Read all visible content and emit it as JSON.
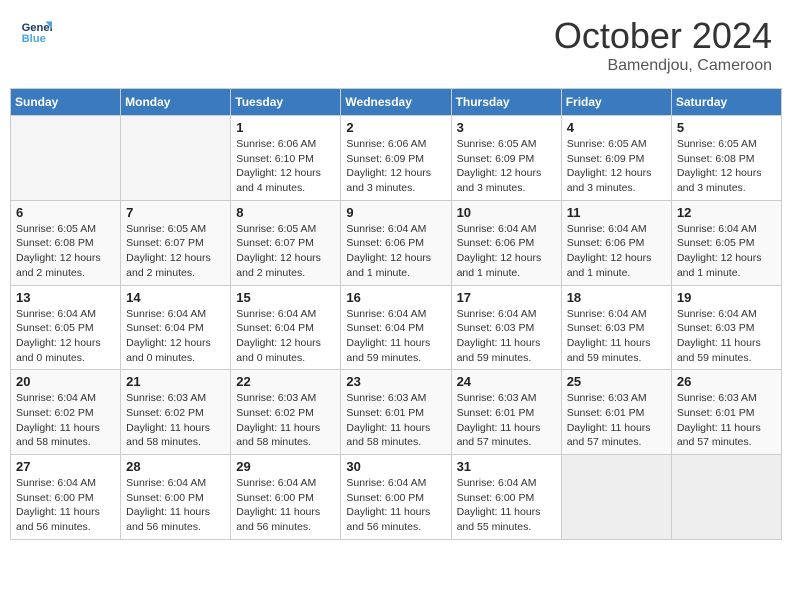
{
  "header": {
    "logo_line1": "General",
    "logo_line2": "Blue",
    "title": "October 2024",
    "location": "Bamendjou, Cameroon"
  },
  "weekdays": [
    "Sunday",
    "Monday",
    "Tuesday",
    "Wednesday",
    "Thursday",
    "Friday",
    "Saturday"
  ],
  "weeks": [
    [
      {
        "day": "",
        "info": ""
      },
      {
        "day": "",
        "info": ""
      },
      {
        "day": "1",
        "info": "Sunrise: 6:06 AM\nSunset: 6:10 PM\nDaylight: 12 hours and 4 minutes."
      },
      {
        "day": "2",
        "info": "Sunrise: 6:06 AM\nSunset: 6:09 PM\nDaylight: 12 hours and 3 minutes."
      },
      {
        "day": "3",
        "info": "Sunrise: 6:05 AM\nSunset: 6:09 PM\nDaylight: 12 hours and 3 minutes."
      },
      {
        "day": "4",
        "info": "Sunrise: 6:05 AM\nSunset: 6:09 PM\nDaylight: 12 hours and 3 minutes."
      },
      {
        "day": "5",
        "info": "Sunrise: 6:05 AM\nSunset: 6:08 PM\nDaylight: 12 hours and 3 minutes."
      }
    ],
    [
      {
        "day": "6",
        "info": "Sunrise: 6:05 AM\nSunset: 6:08 PM\nDaylight: 12 hours and 2 minutes."
      },
      {
        "day": "7",
        "info": "Sunrise: 6:05 AM\nSunset: 6:07 PM\nDaylight: 12 hours and 2 minutes."
      },
      {
        "day": "8",
        "info": "Sunrise: 6:05 AM\nSunset: 6:07 PM\nDaylight: 12 hours and 2 minutes."
      },
      {
        "day": "9",
        "info": "Sunrise: 6:04 AM\nSunset: 6:06 PM\nDaylight: 12 hours and 1 minute."
      },
      {
        "day": "10",
        "info": "Sunrise: 6:04 AM\nSunset: 6:06 PM\nDaylight: 12 hours and 1 minute."
      },
      {
        "day": "11",
        "info": "Sunrise: 6:04 AM\nSunset: 6:06 PM\nDaylight: 12 hours and 1 minute."
      },
      {
        "day": "12",
        "info": "Sunrise: 6:04 AM\nSunset: 6:05 PM\nDaylight: 12 hours and 1 minute."
      }
    ],
    [
      {
        "day": "13",
        "info": "Sunrise: 6:04 AM\nSunset: 6:05 PM\nDaylight: 12 hours and 0 minutes."
      },
      {
        "day": "14",
        "info": "Sunrise: 6:04 AM\nSunset: 6:04 PM\nDaylight: 12 hours and 0 minutes."
      },
      {
        "day": "15",
        "info": "Sunrise: 6:04 AM\nSunset: 6:04 PM\nDaylight: 12 hours and 0 minutes."
      },
      {
        "day": "16",
        "info": "Sunrise: 6:04 AM\nSunset: 6:04 PM\nDaylight: 11 hours and 59 minutes."
      },
      {
        "day": "17",
        "info": "Sunrise: 6:04 AM\nSunset: 6:03 PM\nDaylight: 11 hours and 59 minutes."
      },
      {
        "day": "18",
        "info": "Sunrise: 6:04 AM\nSunset: 6:03 PM\nDaylight: 11 hours and 59 minutes."
      },
      {
        "day": "19",
        "info": "Sunrise: 6:04 AM\nSunset: 6:03 PM\nDaylight: 11 hours and 59 minutes."
      }
    ],
    [
      {
        "day": "20",
        "info": "Sunrise: 6:04 AM\nSunset: 6:02 PM\nDaylight: 11 hours and 58 minutes."
      },
      {
        "day": "21",
        "info": "Sunrise: 6:03 AM\nSunset: 6:02 PM\nDaylight: 11 hours and 58 minutes."
      },
      {
        "day": "22",
        "info": "Sunrise: 6:03 AM\nSunset: 6:02 PM\nDaylight: 11 hours and 58 minutes."
      },
      {
        "day": "23",
        "info": "Sunrise: 6:03 AM\nSunset: 6:01 PM\nDaylight: 11 hours and 58 minutes."
      },
      {
        "day": "24",
        "info": "Sunrise: 6:03 AM\nSunset: 6:01 PM\nDaylight: 11 hours and 57 minutes."
      },
      {
        "day": "25",
        "info": "Sunrise: 6:03 AM\nSunset: 6:01 PM\nDaylight: 11 hours and 57 minutes."
      },
      {
        "day": "26",
        "info": "Sunrise: 6:03 AM\nSunset: 6:01 PM\nDaylight: 11 hours and 57 minutes."
      }
    ],
    [
      {
        "day": "27",
        "info": "Sunrise: 6:04 AM\nSunset: 6:00 PM\nDaylight: 11 hours and 56 minutes."
      },
      {
        "day": "28",
        "info": "Sunrise: 6:04 AM\nSunset: 6:00 PM\nDaylight: 11 hours and 56 minutes."
      },
      {
        "day": "29",
        "info": "Sunrise: 6:04 AM\nSunset: 6:00 PM\nDaylight: 11 hours and 56 minutes."
      },
      {
        "day": "30",
        "info": "Sunrise: 6:04 AM\nSunset: 6:00 PM\nDaylight: 11 hours and 56 minutes."
      },
      {
        "day": "31",
        "info": "Sunrise: 6:04 AM\nSunset: 6:00 PM\nDaylight: 11 hours and 55 minutes."
      },
      {
        "day": "",
        "info": ""
      },
      {
        "day": "",
        "info": ""
      }
    ]
  ]
}
